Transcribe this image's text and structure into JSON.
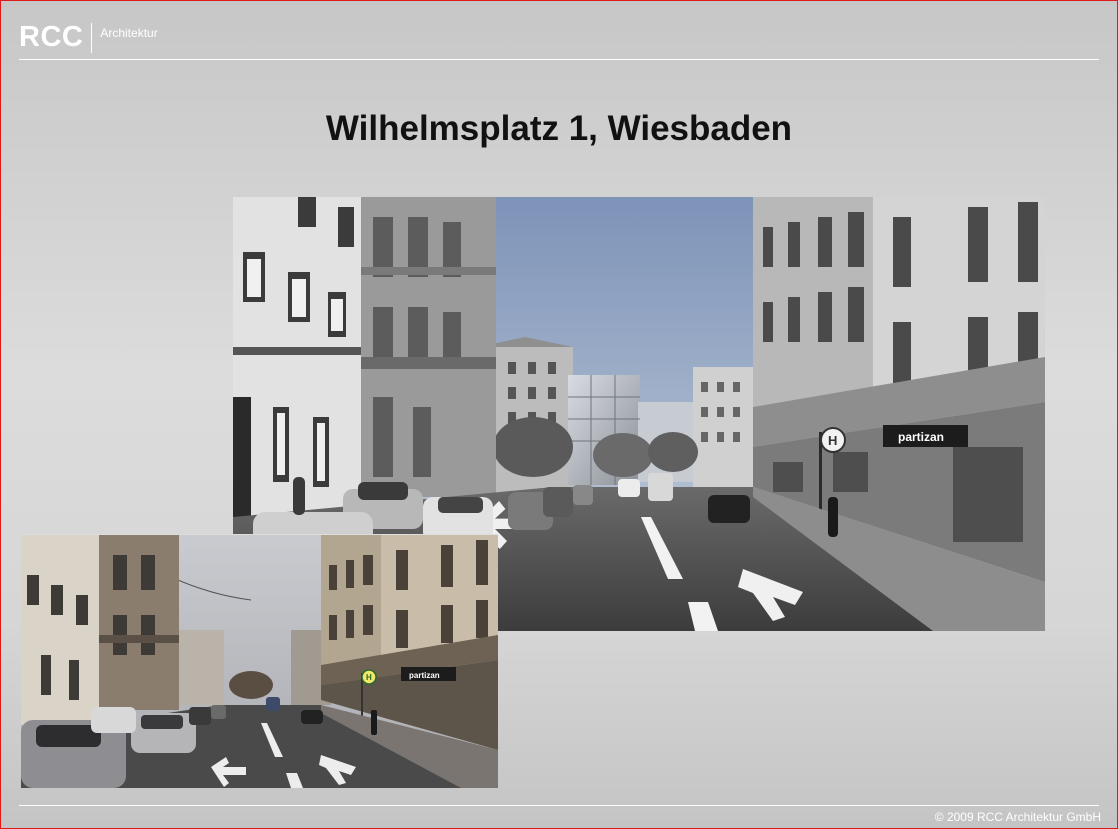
{
  "header": {
    "logo_main": "RCC",
    "logo_sub": "Architektur"
  },
  "slide": {
    "title": "Wilhelmsplatz 1, Wiesbaden"
  },
  "photos": {
    "large": {
      "sign_shop": "partizan",
      "sign_stop": "H"
    },
    "small": {
      "sign_shop": "partizan",
      "sign_stop": "H"
    }
  },
  "footer": {
    "copyright": "© 2009 RCC Architektur GmbH"
  }
}
